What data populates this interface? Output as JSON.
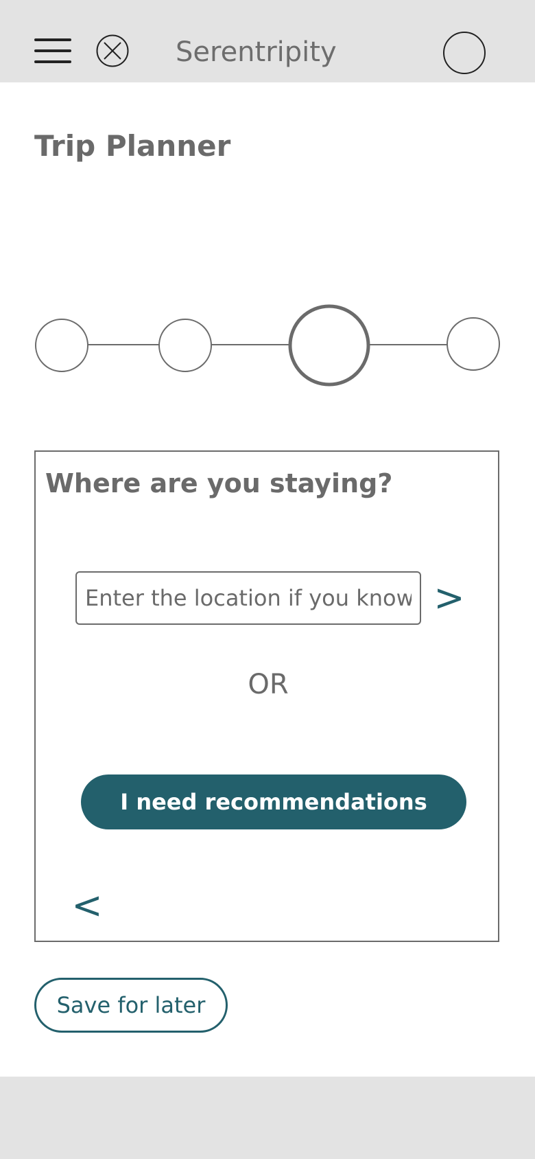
{
  "header": {
    "app_title": "Serentripity",
    "menu_icon": "hamburger-menu-icon",
    "close_icon": "circle-x-icon",
    "avatar_icon": "profile-avatar-icon"
  },
  "page": {
    "title": "Trip Planner"
  },
  "stepper": {
    "steps": 4,
    "current_step": 3
  },
  "card": {
    "question": "Where are you staying?",
    "location_placeholder": "Enter the location if you know",
    "next_label": ">",
    "or_label": "OR",
    "recommend_label": "I need recommendations",
    "back_label": "<"
  },
  "actions": {
    "save_label": "Save for later"
  },
  "colors": {
    "accent": "#23606c",
    "bar_bg": "#e3e3e3",
    "text_gray": "#6a6a6a"
  }
}
